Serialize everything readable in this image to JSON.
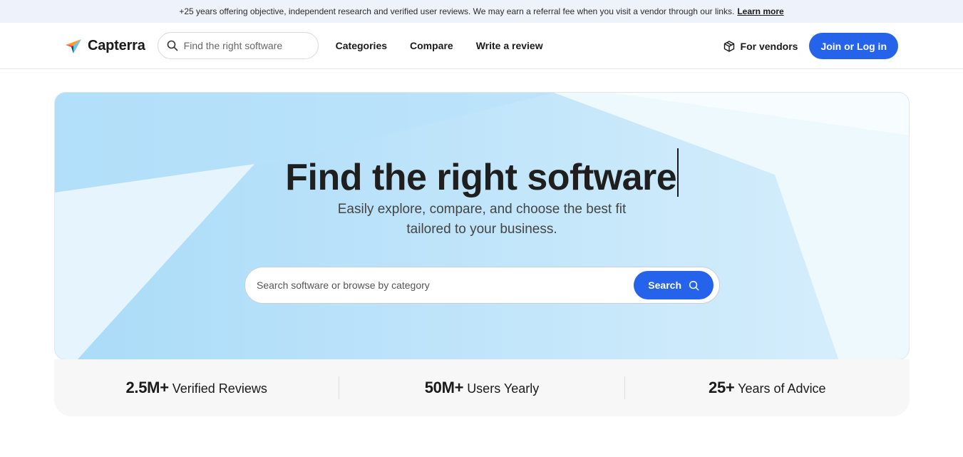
{
  "banner": {
    "text": "+25 years offering objective, independent research and verified user reviews. We may earn a referral fee when you visit a vendor through our links.",
    "link": "Learn more"
  },
  "nav": {
    "logo": "Capterra",
    "search_placeholder": "Find the right software",
    "links": [
      "Categories",
      "Compare",
      "Write a review"
    ],
    "vendors": "For vendors",
    "join": "Join or Log in"
  },
  "hero": {
    "title": "Find the right software",
    "subtitle_line1": "Easily explore, compare, and choose the best fit",
    "subtitle_line2": "tailored to your business.",
    "search_placeholder": "Search software or browse by category",
    "search_button": "Search"
  },
  "stats": [
    {
      "num": "2.5M+",
      "label": "Verified Reviews"
    },
    {
      "num": "50M+",
      "label": "Users Yearly"
    },
    {
      "num": "25+",
      "label": "Years of Advice"
    }
  ],
  "colors": {
    "accent": "#2563eb",
    "hero_bg": "#d3ecfb",
    "banner_bg": "#eef2fb"
  }
}
